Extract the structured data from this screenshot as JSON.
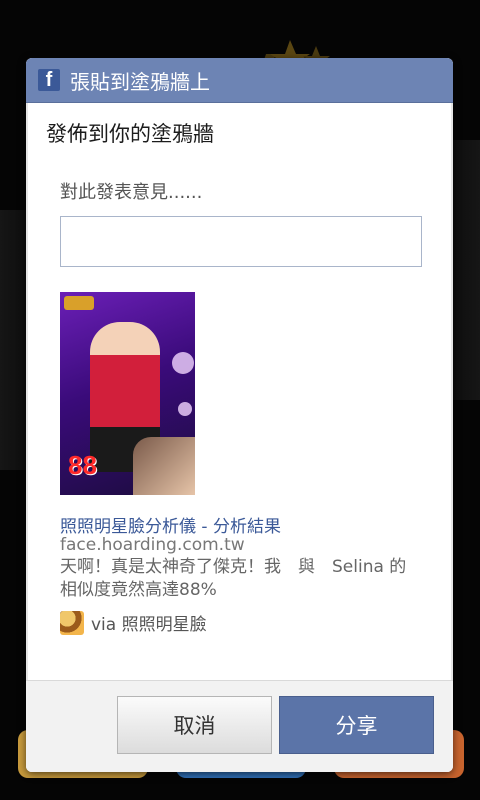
{
  "dialog": {
    "title": "張貼到塗鴉牆上",
    "subtitle": "發佈到你的塗鴉牆",
    "comment_label": "對此發表意見......",
    "comment_value": ""
  },
  "post": {
    "image_icon": "selina-photo-thumbnail",
    "score_text": "88",
    "link_title": "照照明星臉分析儀 - 分析結果",
    "link_url": "face.hoarding.com.tw",
    "description": "天啊！真是太神奇了傑克！我　與　Selina 的相似度竟然高達88%",
    "via_text": "via 照照明星臉"
  },
  "buttons": {
    "cancel": "取消",
    "share": "分享"
  },
  "colors": {
    "titlebar": "#6d84b4",
    "share_button": "#5b74a8",
    "link": "#3b5998"
  }
}
